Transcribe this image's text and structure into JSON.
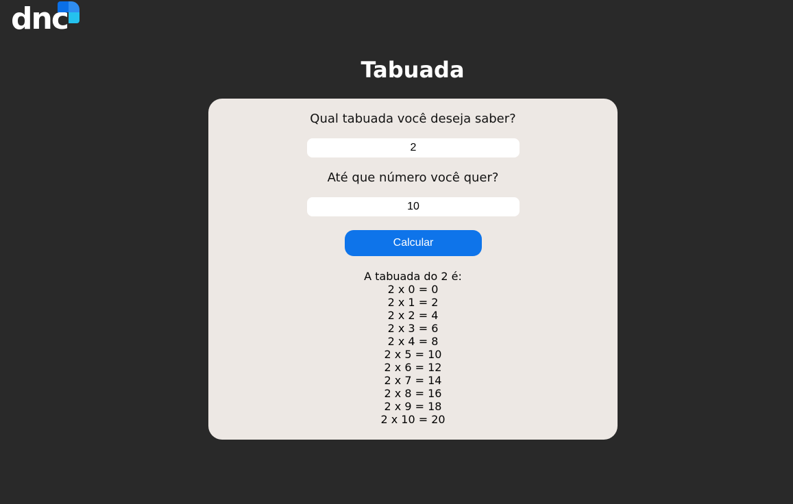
{
  "brand": {
    "logo_text": "dnc",
    "accent_colors": [
      "#0a6fe6",
      "#24c1ee",
      "#43a6f0"
    ]
  },
  "page": {
    "title": "Tabuada"
  },
  "form": {
    "question_table": "Qual tabuada você deseja saber?",
    "table_value": "2",
    "question_limit": "Até que número você quer?",
    "limit_value": "10",
    "calculate_label": "Calcular"
  },
  "result": {
    "heading": "A tabuada do 2 é:",
    "lines": [
      "2 x 0 = 0",
      "2 x 1 = 2",
      "2 x 2 = 4",
      "2 x 3 = 6",
      "2 x 4 = 8",
      "2 x 5 = 10",
      "2 x 6 = 12",
      "2 x 7 = 14",
      "2 x 8 = 16",
      "2 x 9 = 18",
      "2 x 10 = 20"
    ]
  }
}
